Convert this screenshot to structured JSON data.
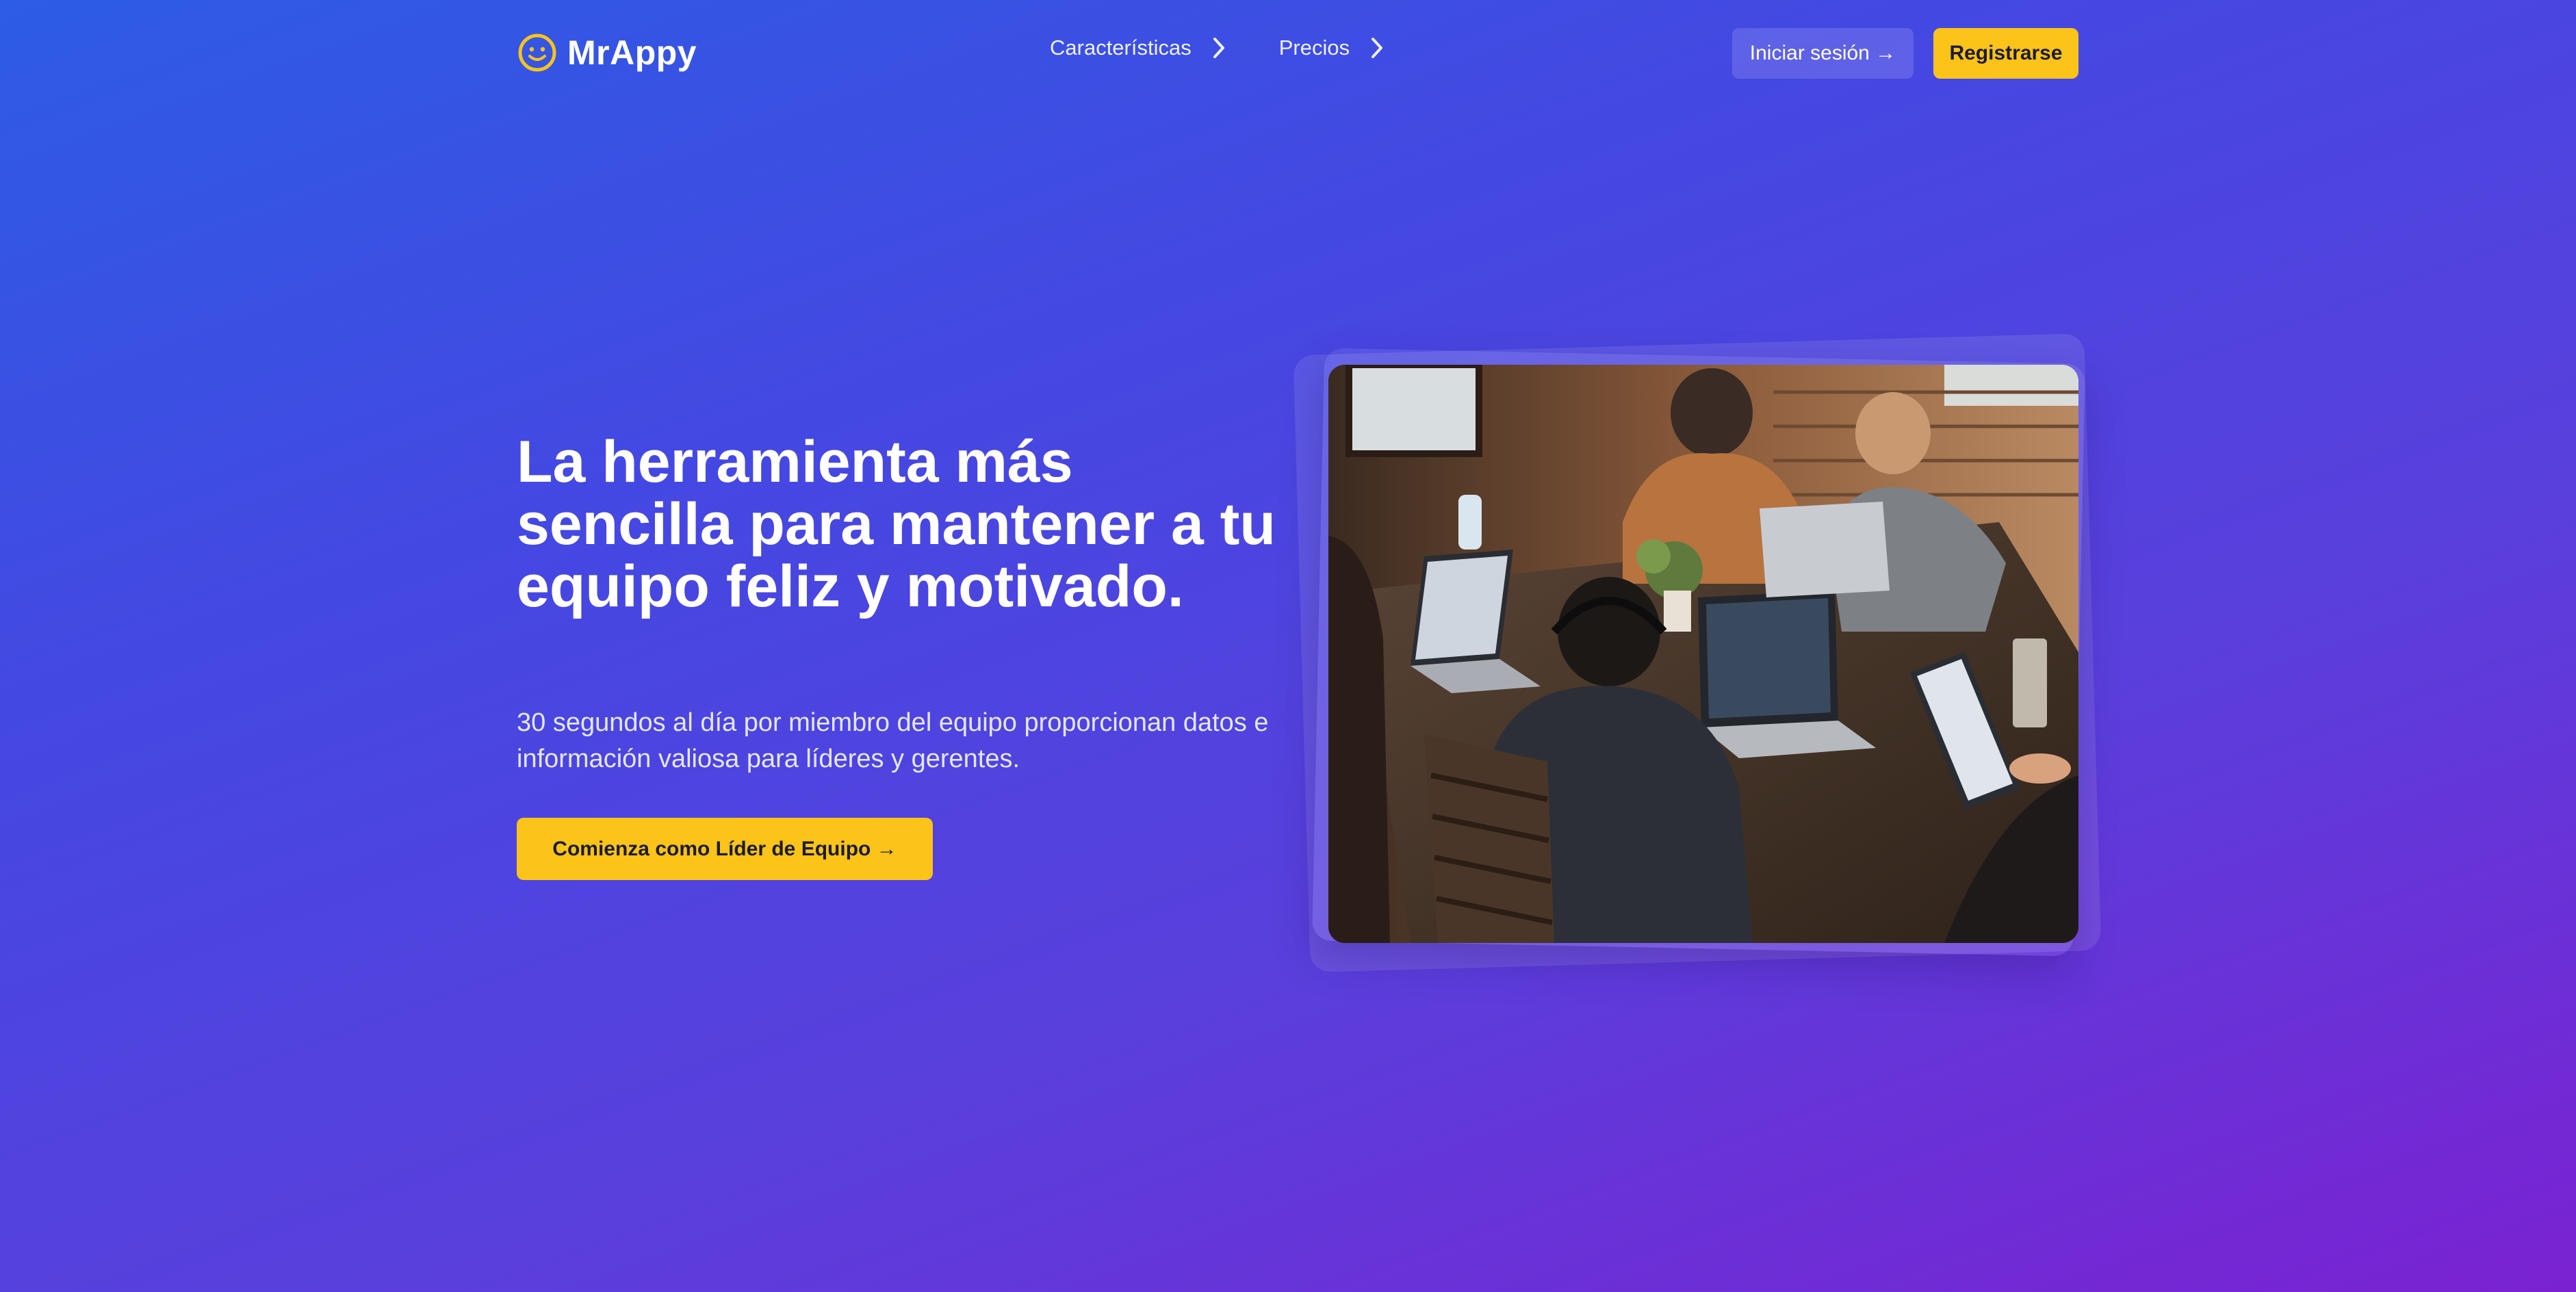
{
  "header": {
    "brand": {
      "name": "MrAppy",
      "icon": "smiley-face-icon"
    },
    "nav": [
      {
        "label": "Características",
        "icon": "chevron-right-icon"
      },
      {
        "label": "Precios",
        "icon": "chevron-right-icon"
      }
    ],
    "login_label": "Iniciar sesión →",
    "signup_label": "Registrarse"
  },
  "hero": {
    "title": "La herramienta más sencilla para mantener a tu equipo feliz y motivado.",
    "subtitle": "30 segundos al día por miembro del equipo proporcionan datos e información valiosa para líderes y gerentes.",
    "cta_label": "Comienza como Líder de Equipo →",
    "image_icon": "team-working-photo"
  },
  "colors": {
    "accent": "#fcc419",
    "gradient_start": "#2d5ce5",
    "gradient_end": "#7a22d2",
    "button_text": "#1d1b33"
  }
}
